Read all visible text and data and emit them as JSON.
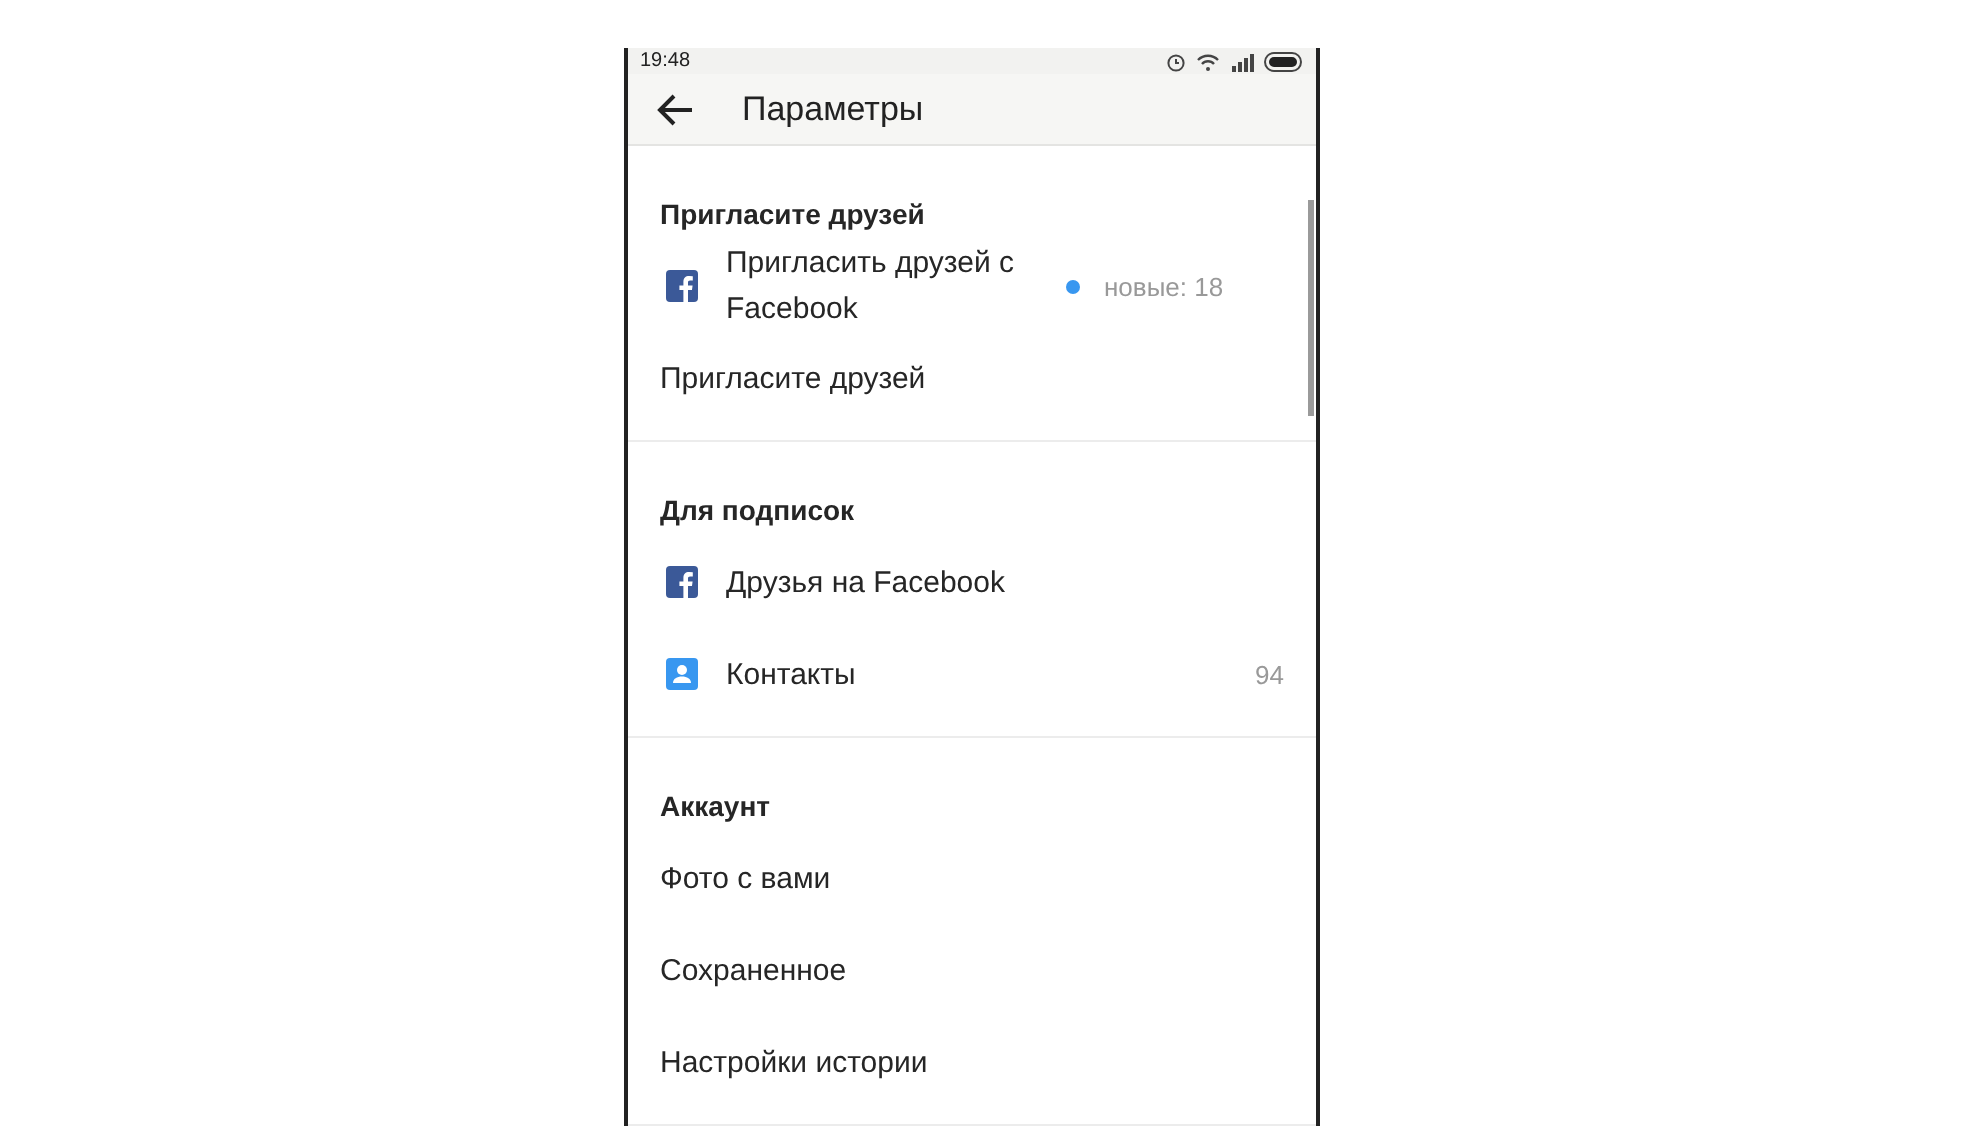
{
  "status_bar": {
    "time": "19:48"
  },
  "header": {
    "title": "Параметры"
  },
  "sections": [
    {
      "title": "Пригласите друзей",
      "rows": [
        {
          "kind": "facebook",
          "label": "Пригласить друзей с Facebook",
          "badge": "новые: 18",
          "dot": true
        },
        {
          "kind": "plain",
          "label": "Пригласите друзей"
        }
      ]
    },
    {
      "title": "Для подписок",
      "rows": [
        {
          "kind": "facebook",
          "label": "Друзья на Facebook"
        },
        {
          "kind": "contacts",
          "label": "Контакты",
          "count": "94"
        }
      ]
    },
    {
      "title": "Аккаунт",
      "rows": [
        {
          "kind": "plain",
          "label": "Фото с вами"
        },
        {
          "kind": "plain",
          "label": "Сохраненное"
        },
        {
          "kind": "plain",
          "label": "Настройки истории"
        }
      ]
    }
  ]
}
